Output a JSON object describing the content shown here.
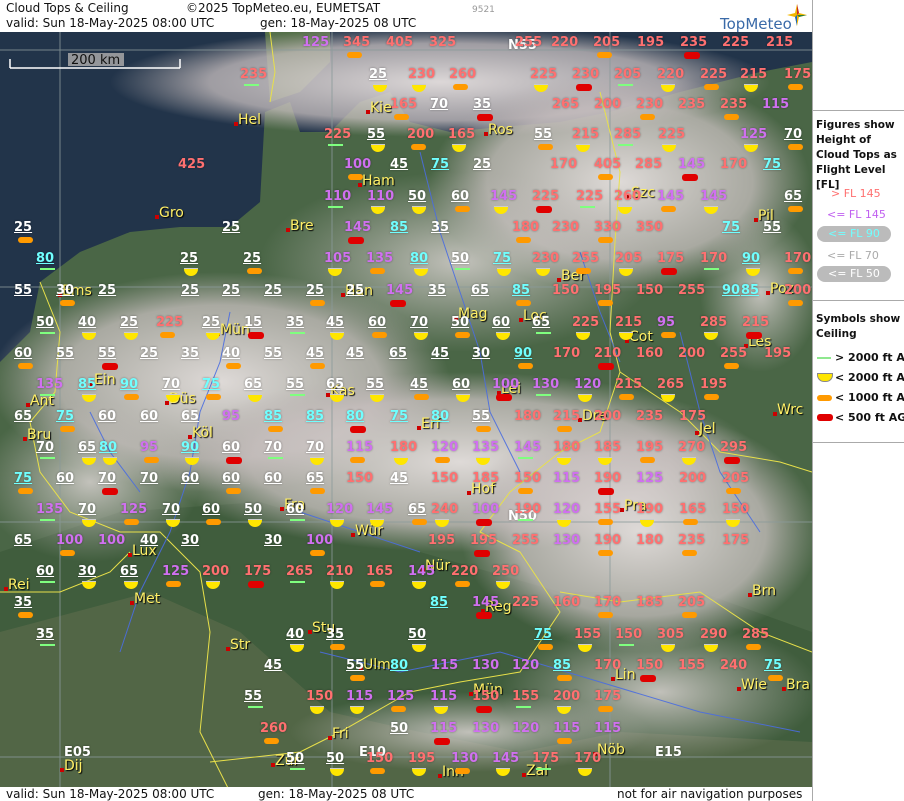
{
  "header": {
    "title": "Cloud Tops & Ceiling",
    "copyright": "©2025 TopMeteo.eu, EUMETSAT",
    "valid": "valid:  Sun  18-May-2025   08:00 UTC",
    "gen": "gen: 18-May-2025 08 UTC",
    "id": "9521",
    "brand": "TopMeteo"
  },
  "footer": {
    "valid": "valid:  Sun  18-May-2025   08:00 UTC",
    "gen": "gen: 18-May-2025 08 UTC",
    "disclaimer": "not for air navigation purposes"
  },
  "scale": {
    "label": "200 km"
  },
  "grid_labels": [
    "N55",
    "N50",
    "E05",
    "E10",
    "E15"
  ],
  "legend": {
    "tops_title": "Figures show Height of Cloud Tops as Flight Level  [FL]",
    "tops": [
      {
        "label": "> FL 145",
        "color": "#ff7070"
      },
      {
        "label": "<= FL 145",
        "color": "#d070f0"
      },
      {
        "label": "<= FL 90",
        "color": "#70ffff"
      },
      {
        "label": "<= FL 70",
        "color": "#ffffff"
      },
      {
        "label": "<= FL 50",
        "color": "#ffffff"
      }
    ],
    "ceiling_title": "Symbols show Ceiling",
    "ceiling": [
      {
        "label": "> 2000 ft AGL",
        "symbol": "green-line"
      },
      {
        "label": "< 2000 ft AGL",
        "symbol": "yellow-half-disc"
      },
      {
        "label": "< 1000 ft AGL",
        "symbol": "orange-bar"
      },
      {
        "label": "< 500 ft AGL",
        "symbol": "red-bar"
      }
    ]
  },
  "colors": {
    "red": "#ff7070",
    "violet": "#d070f0",
    "cyan": "#70ffff",
    "white": "#ffffff",
    "city": "#ffef66"
  },
  "cities": [
    "Hel",
    "Kie",
    "Ros",
    "Ham",
    "Gro",
    "Bre",
    "Szc",
    "Pil",
    "Ber",
    "Ems",
    "Han",
    "Poz",
    "Mün",
    "Mag",
    "Loc",
    "Cot",
    "Les",
    "Ein",
    "Lei",
    "Ant",
    "Düs",
    "Kas",
    "Dre",
    "Wrc",
    "Bru",
    "Köl",
    "Erf",
    "Jel",
    "Hof",
    "Fra",
    "Pra",
    "Lux",
    "Wür",
    "Nür",
    "Brn",
    "Rei",
    "Met",
    "Reg",
    "Str",
    "Stu",
    "Ulm",
    "Lin",
    "Mün",
    "Wie",
    "Bra",
    "Fri",
    "Dij",
    "Zür",
    "Inn",
    "Zal",
    "Nöb"
  ],
  "cloud_tops": [
    [
      "125",
      "345",
      "405",
      "325",
      "255",
      "220",
      "205",
      "195",
      "235",
      "225",
      "215",
      "225"
    ],
    [
      "235",
      "25",
      "230",
      "260",
      "225",
      "230",
      "205",
      "220",
      "225",
      "215",
      "175"
    ],
    [
      "165",
      "70",
      "35",
      "265",
      "200",
      "230",
      "235",
      "235",
      "115"
    ],
    [
      "225",
      "55",
      "200",
      "165",
      "55",
      "215",
      "285",
      "225",
      "125",
      "70"
    ],
    [
      "425",
      "100",
      "45",
      "75",
      "25",
      "170",
      "405",
      "285",
      "145",
      "170",
      "75"
    ],
    [
      "110",
      "110",
      "50",
      "60",
      "145",
      "225",
      "225",
      "260",
      "145",
      "145",
      "65"
    ],
    [
      "25",
      "25",
      "145",
      "85",
      "35",
      "180",
      "230",
      "330",
      "350",
      "75",
      "55"
    ],
    [
      "80",
      "25",
      "25",
      "105",
      "135",
      "80",
      "50",
      "75",
      "230",
      "255",
      "205",
      "175",
      "170",
      "90",
      "170"
    ],
    [
      "55",
      "30",
      "25",
      "25",
      "25",
      "25",
      "25",
      "25",
      "145",
      "35",
      "65",
      "85",
      "150",
      "195",
      "150",
      "255",
      "90",
      "85",
      "200"
    ],
    [
      "50",
      "40",
      "25",
      "225",
      "25",
      "15",
      "35",
      "45",
      "60",
      "70",
      "50",
      "60",
      "65",
      "225",
      "215",
      "95",
      "285",
      "215"
    ],
    [
      "60",
      "55",
      "55",
      "25",
      "35",
      "40",
      "55",
      "45",
      "45",
      "65",
      "45",
      "30",
      "90",
      "170",
      "210",
      "160",
      "200",
      "255",
      "195"
    ],
    [
      "135",
      "85",
      "90",
      "70",
      "75",
      "65",
      "55",
      "65",
      "55",
      "45",
      "60",
      "100",
      "130",
      "120",
      "215",
      "265",
      "195"
    ],
    [
      "65",
      "75",
      "60",
      "60",
      "65",
      "95",
      "85",
      "85",
      "80",
      "75",
      "80",
      "55",
      "180",
      "215",
      "200",
      "235",
      "175"
    ],
    [
      "70",
      "65",
      "80",
      "95",
      "90",
      "60",
      "70",
      "70",
      "115",
      "180",
      "120",
      "135",
      "145",
      "180",
      "185",
      "195",
      "270",
      "295"
    ],
    [
      "75",
      "60",
      "70",
      "70",
      "60",
      "60",
      "60",
      "65",
      "150",
      "45",
      "150",
      "185",
      "150",
      "115",
      "190",
      "125",
      "200",
      "205"
    ],
    [
      "135",
      "70",
      "125",
      "70",
      "60",
      "50",
      "60",
      "120",
      "145",
      "65",
      "240",
      "100",
      "190",
      "120",
      "155",
      "190",
      "165",
      "150"
    ],
    [
      "65",
      "100",
      "100",
      "40",
      "30",
      "30",
      "100",
      "195",
      "195",
      "255",
      "130",
      "190",
      "180",
      "235",
      "175"
    ],
    [
      "60",
      "30",
      "65",
      "125",
      "200",
      "175",
      "265",
      "210",
      "165",
      "145",
      "220",
      "250"
    ],
    [
      "35",
      "85",
      "145",
      "225",
      "160",
      "170",
      "185",
      "205"
    ],
    [
      "35",
      "40",
      "35",
      "50",
      "75",
      "155",
      "150",
      "305",
      "290",
      "285"
    ],
    [
      "45",
      "55",
      "80",
      "115",
      "130",
      "120",
      "85",
      "170",
      "150",
      "155",
      "240",
      "75"
    ],
    [
      "55",
      "150",
      "115",
      "125",
      "115",
      "150",
      "155",
      "200",
      "175"
    ],
    [
      "260",
      "50",
      "115",
      "130",
      "120",
      "115",
      "115"
    ],
    [
      "50",
      "50",
      "150",
      "195",
      "130",
      "145",
      "175",
      "170"
    ]
  ],
  "ceiling_symbols": {
    "yellow": "< 2000 ft AGL",
    "orange": "< 1000 ft AGL",
    "red": "< 500 ft AGL",
    "green": "> 2000 ft AGL"
  }
}
